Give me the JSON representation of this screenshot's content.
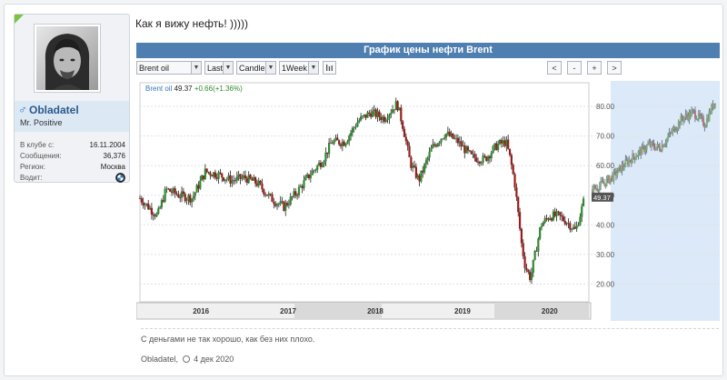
{
  "user": {
    "name": "Obladatel",
    "title": "Mr. Positive",
    "gender_icon": "male-icon",
    "info": [
      {
        "label": "В клубе с:",
        "value": "16.11.2004"
      },
      {
        "label": "Сообщения:",
        "value": "36,376"
      },
      {
        "label": "Регион:",
        "value": "Москва"
      },
      {
        "label": "Водит:",
        "value": ""
      }
    ]
  },
  "post": {
    "message": "Как я вижу нефть! )))))",
    "signature": "С деньгами не так хорошо, как без них плохо.",
    "author": "Obladatel",
    "date": "4 дек 2020"
  },
  "chart_data": {
    "type": "candlestick",
    "title": "График цены нефти Brent",
    "controls": {
      "instrument": "Brent oil",
      "price_type": "Last",
      "chart_type": "Candle",
      "interval": "1Week",
      "nav": [
        "<",
        "-",
        "+",
        ">"
      ]
    },
    "legend": {
      "name": "Brent oil",
      "price": "49.37",
      "change": "+0.66(+1.36%)"
    },
    "last_price_label": "49.37",
    "y_ticks": [
      "80.00",
      "70.00",
      "60.00",
      "50.00",
      "40.00",
      "30.00",
      "20.00"
    ],
    "y_tick_values": [
      80,
      70,
      60,
      50,
      40,
      30,
      20
    ],
    "ylim": [
      14,
      88
    ],
    "x_labels": [
      "2016",
      "2017",
      "2018",
      "2019",
      "2020"
    ],
    "x_label_years": [
      2016,
      2017,
      2018,
      2019,
      2020
    ],
    "xlim": [
      2015.8,
      2020.95
    ],
    "series": [
      {
        "x": [
          2015.8,
          2015.9,
          2016.0,
          2016.1,
          2016.25,
          2016.4,
          2016.55,
          2016.7,
          2016.85,
          2017.0,
          2017.15,
          2017.3,
          2017.45,
          2017.6,
          2017.75,
          2017.9,
          2018.0,
          2018.15,
          2018.3,
          2018.45,
          2018.6,
          2018.75,
          2018.82,
          2018.9,
          2019.0,
          2019.15,
          2019.3,
          2019.45,
          2019.6,
          2019.75,
          2019.9,
          2020.0,
          2020.05,
          2020.1,
          2020.18,
          2020.22,
          2020.28,
          2020.32,
          2020.4,
          2020.5,
          2020.6,
          2020.7,
          2020.8,
          2020.9
        ],
        "close": [
          49,
          46,
          43,
          52,
          50,
          49,
          58,
          57,
          55,
          56,
          54,
          49,
          46,
          51,
          57,
          62,
          68,
          68,
          75,
          78,
          76,
          81,
          73,
          61,
          55,
          66,
          71,
          68,
          63,
          62,
          67,
          68,
          62,
          54,
          33,
          26,
          22,
          28,
          40,
          43,
          43,
          41,
          38,
          49
        ]
      }
    ],
    "forecast": {
      "x": [
        2020.9,
        2021.0,
        2021.1,
        2021.2,
        2021.3,
        2021.4,
        2021.5,
        2021.6,
        2021.7,
        2021.8,
        2021.9,
        2022.0
      ],
      "close": [
        52,
        54,
        57,
        61,
        64,
        67,
        66,
        71,
        76,
        78,
        74,
        83
      ]
    }
  }
}
